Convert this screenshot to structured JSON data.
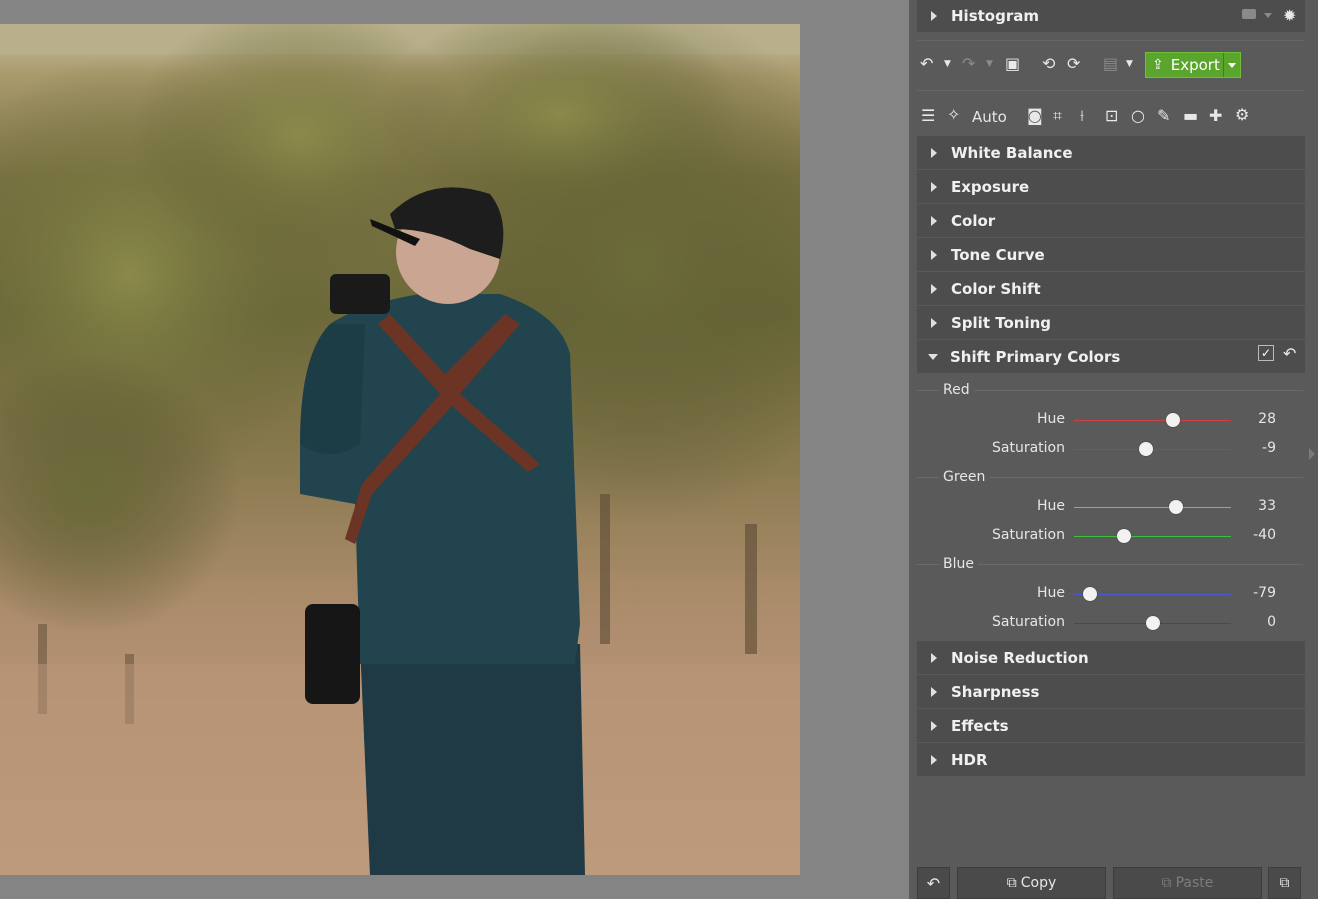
{
  "panel": {
    "histogram_label": "Histogram",
    "auto_label": "Auto",
    "export_label": "Export",
    "sections_top": [
      "White Balance",
      "Exposure",
      "Color",
      "Tone Curve",
      "Color Shift",
      "Split Toning"
    ],
    "open_section": "Shift Primary Colors",
    "sections_bottom": [
      "Noise Reduction",
      "Sharpness",
      "Effects",
      "HDR"
    ],
    "groups": [
      {
        "name": "Red",
        "sliders": [
          {
            "label": "Hue",
            "value": "28",
            "fraction": 0.63,
            "color": "#d04040"
          },
          {
            "label": "Saturation",
            "value": "-9",
            "fraction": 0.46,
            "color": "#d03040"
          }
        ]
      },
      {
        "name": "Green",
        "sliders": [
          {
            "label": "Hue",
            "value": "33",
            "fraction": 0.65,
            "color": "#5ccf4a"
          },
          {
            "label": "Saturation",
            "value": "-40",
            "fraction": 0.32,
            "color": "#3cbf3a"
          }
        ]
      },
      {
        "name": "Blue",
        "sliders": [
          {
            "label": "Hue",
            "value": "-79",
            "fraction": 0.1,
            "color": "#4a5ad0"
          },
          {
            "label": "Saturation",
            "value": "0",
            "fraction": 0.5,
            "color": "#3a3ac8"
          }
        ]
      }
    ],
    "copy_label": "Copy",
    "paste_label": "Paste"
  },
  "colors": {
    "accent": "#5aa62c",
    "panel": "#5a5a5a",
    "header": "#4d4d4d"
  },
  "icons": [
    "camera-icon",
    "gear-icon",
    "undo-icon",
    "redo-icon",
    "image-icon",
    "rotate-left-icon",
    "rotate-right-icon",
    "save-icon",
    "export-icon",
    "sliders-icon",
    "wand-icon",
    "camera-tool-icon",
    "crop-icon",
    "perspective-icon",
    "graduated-filter-icon",
    "circle-filter-icon",
    "brush-icon",
    "eraser-icon",
    "bandage-icon",
    "settings-icon",
    "checkbox-icon",
    "reset-icon",
    "copy-icon",
    "paste-icon",
    "duplicate-icon"
  ]
}
